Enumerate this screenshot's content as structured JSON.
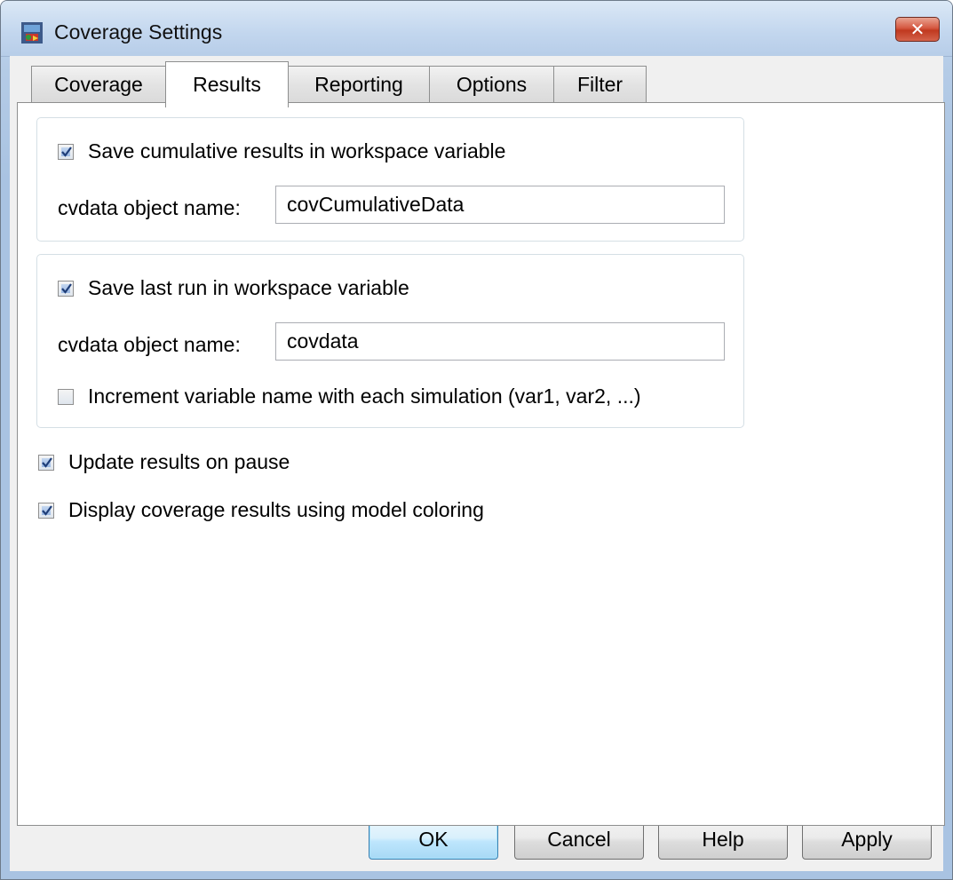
{
  "window": {
    "title": "Coverage Settings",
    "close_glyph": "✕"
  },
  "tabs": [
    {
      "label": "Coverage",
      "active": false
    },
    {
      "label": "Results",
      "active": true
    },
    {
      "label": "Reporting",
      "active": false
    },
    {
      "label": "Options",
      "active": false
    },
    {
      "label": "Filter",
      "active": false
    }
  ],
  "cumulative_group": {
    "checkbox_label": "Save cumulative results in workspace variable",
    "checked": true,
    "name_label": "cvdata object name:",
    "name_value": "covCumulativeData"
  },
  "lastrun_group": {
    "checkbox_label": "Save last run in workspace variable",
    "checked": true,
    "name_label": "cvdata object name:",
    "name_value": "covdata",
    "increment_label": "Increment variable name with each simulation (var1, var2, ...)",
    "increment_checked": false
  },
  "options": [
    {
      "label": "Update results on pause",
      "checked": true
    },
    {
      "label": "Display coverage results using model coloring",
      "checked": true
    }
  ],
  "buttons": {
    "ok": "OK",
    "cancel": "Cancel",
    "help": "Help",
    "apply": "Apply"
  },
  "icons": {
    "app": "simulink-coverage-icon",
    "checkmark": "checkmark-icon",
    "close": "close-icon"
  }
}
